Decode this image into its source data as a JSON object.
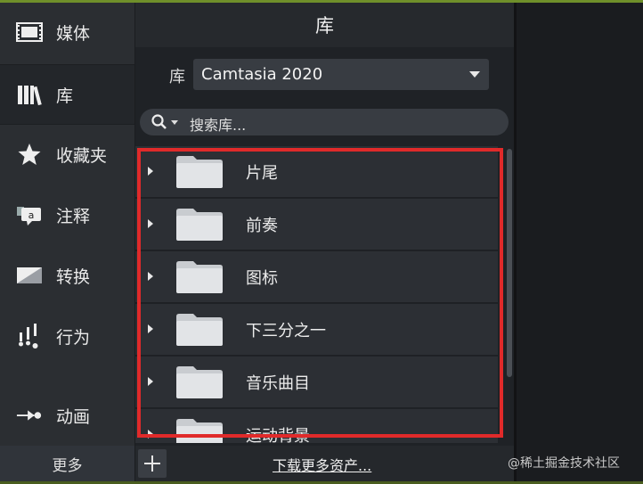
{
  "sidebar": {
    "items": [
      {
        "label": "媒体",
        "icon": "film-strip-icon"
      },
      {
        "label": "库",
        "icon": "library-books-icon"
      },
      {
        "label": "收藏夹",
        "icon": "star-icon"
      },
      {
        "label": "注释",
        "icon": "annotation-callout-icon"
      },
      {
        "label": "转换",
        "icon": "transition-icon"
      },
      {
        "label": "行为",
        "icon": "behaviors-icon"
      },
      {
        "label": "动画",
        "icon": "animation-arrow-icon"
      }
    ],
    "active": "库",
    "more_label": "更多"
  },
  "panel": {
    "title": "库",
    "library_label": "库",
    "library_selected": "Camtasia 2020",
    "search_placeholder": "搜索库..."
  },
  "folders": [
    {
      "name": "片尾"
    },
    {
      "name": "前奏"
    },
    {
      "name": "图标"
    },
    {
      "name": "下三分之一"
    },
    {
      "name": "音乐曲目"
    },
    {
      "name": "运动背景"
    }
  ],
  "bottom": {
    "download_label": "下载更多资产..."
  },
  "watermark": "@稀土掘金技术社区",
  "colors": {
    "highlight": "#e02a2a",
    "accent": "#6f8f2a"
  }
}
